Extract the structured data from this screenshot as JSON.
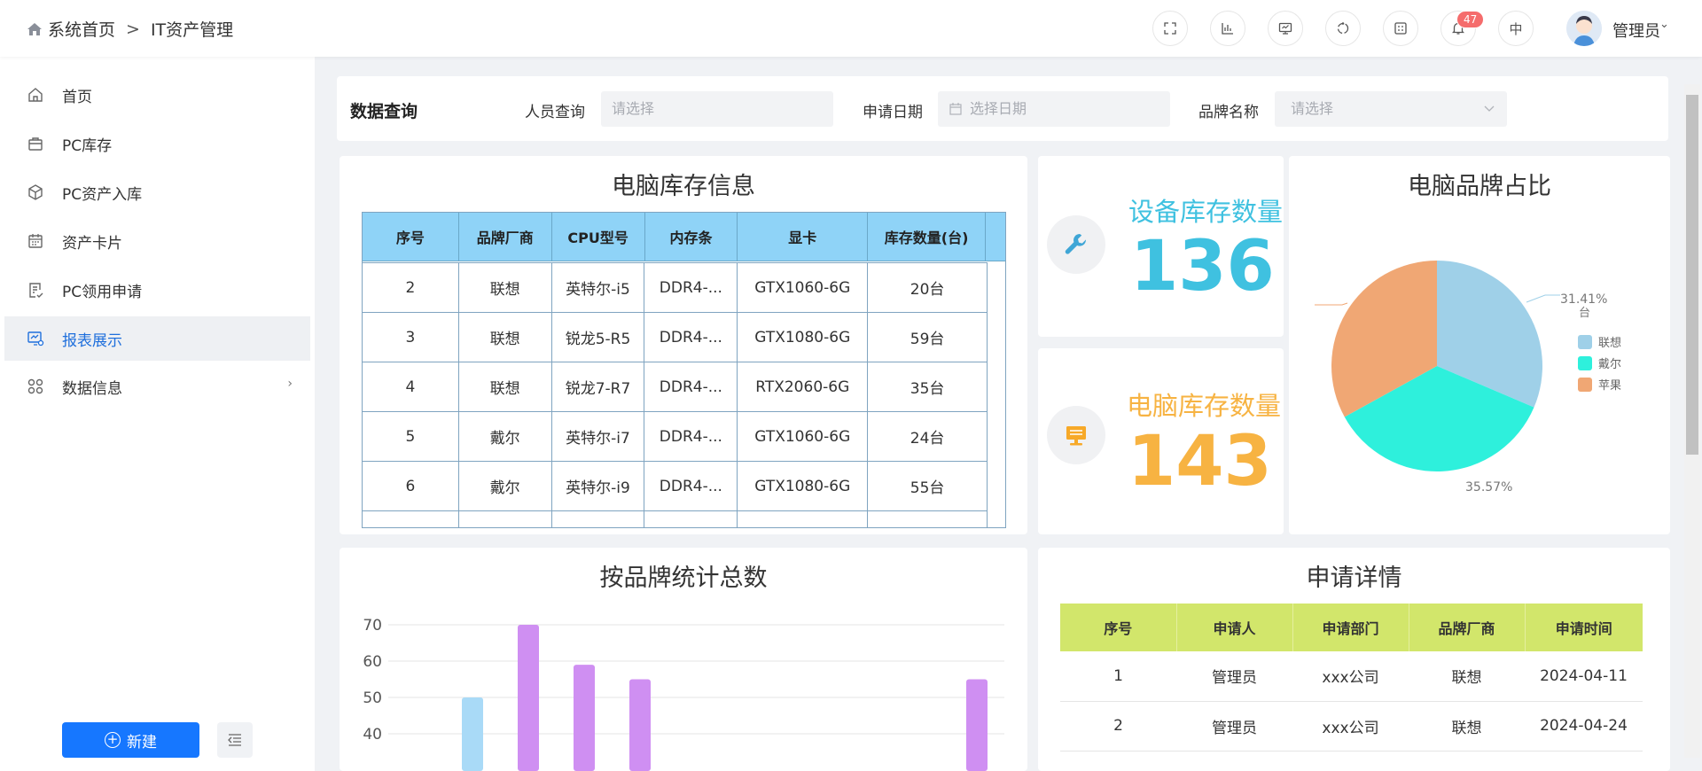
{
  "breadcrumb": {
    "home": "系统首页",
    "current": "IT资产管理"
  },
  "header": {
    "notification_count": "47",
    "lang": "中",
    "username": "管理员",
    "icons": [
      "fullscreen-icon",
      "bar-chart-icon",
      "monitor-icon",
      "recycle-icon",
      "calculator-icon",
      "bell-icon"
    ]
  },
  "sidebar": {
    "items": [
      {
        "label": "首页",
        "icon": "home-icon"
      },
      {
        "label": "PC库存",
        "icon": "briefcase-icon"
      },
      {
        "label": "PC资产入库",
        "icon": "box-icon"
      },
      {
        "label": "资产卡片",
        "icon": "calendar-icon"
      },
      {
        "label": "PC领用申请",
        "icon": "document-icon"
      },
      {
        "label": "报表展示",
        "icon": "chart-report-icon",
        "active": true
      },
      {
        "label": "数据信息",
        "icon": "grid-icon"
      }
    ],
    "new_button": "新建"
  },
  "query": {
    "title": "数据查询",
    "person_label": "人员查询",
    "person_placeholder": "请选择",
    "date_label": "申请日期",
    "date_placeholder": "选择日期",
    "brand_label": "品牌名称",
    "brand_placeholder": "请选择"
  },
  "inventory": {
    "title": "电脑库存信息",
    "headers": [
      "序号",
      "品牌厂商",
      "CPU型号",
      "内存条",
      "显卡",
      "库存数量(台)"
    ],
    "rows": [
      [
        "2",
        "联想",
        "英特尔-i5",
        "DDR4-...",
        "GTX1060-6G",
        "20台"
      ],
      [
        "3",
        "联想",
        "锐龙5-R5",
        "DDR4-...",
        "GTX1080-6G",
        "59台"
      ],
      [
        "4",
        "联想",
        "锐龙7-R7",
        "DDR4-...",
        "RTX2060-6G",
        "35台"
      ],
      [
        "5",
        "戴尔",
        "英特尔-i7",
        "DDR4-...",
        "GTX1060-6G",
        "24台"
      ],
      [
        "6",
        "戴尔",
        "英特尔-i9",
        "DDR4-...",
        "GTX1080-6G",
        "55台"
      ]
    ]
  },
  "stats": {
    "device_label": "设备库存数量",
    "device_value": "136",
    "pc_label": "电脑库存数量",
    "pc_value": "143",
    "device_color": "#3fc1e0",
    "pc_color": "#f7b342"
  },
  "brand_pie": {
    "title": "电脑品牌占比",
    "label_top": "31.41%",
    "label_top_unit": "台",
    "label_bottom": "35.57%"
  },
  "bar_panel": {
    "title": "按品牌统计总数"
  },
  "applications": {
    "title": "申请详情",
    "headers": [
      "序号",
      "申请人",
      "申请部门",
      "品牌厂商",
      "申请时间"
    ],
    "rows": [
      [
        "1",
        "管理员",
        "xxx公司",
        "联想",
        "2024-04-11"
      ],
      [
        "2",
        "管理员",
        "xxx公司",
        "联想",
        "2024-04-24"
      ]
    ]
  },
  "chart_data": [
    {
      "type": "pie",
      "title": "电脑品牌占比",
      "categories": [
        "联想",
        "戴尔",
        "苹果"
      ],
      "values": [
        31.41,
        35.57,
        33.02
      ],
      "colors": [
        "#9fd0e8",
        "#2ef0dc",
        "#f0a774"
      ],
      "legend": "right"
    },
    {
      "type": "bar",
      "title": "按品牌统计总数",
      "yticks": [
        40,
        50,
        60,
        70
      ],
      "ylim": [
        40,
        70
      ],
      "grid": true,
      "values": [
        50,
        70,
        59,
        55,
        55
      ],
      "colors": [
        "#a9daf7",
        "#cf8ff2",
        "#cf8ff2",
        "#cf8ff2",
        "#cf8ff2"
      ]
    }
  ]
}
